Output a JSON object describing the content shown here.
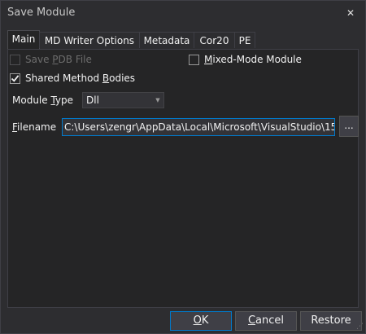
{
  "window": {
    "title": "Save Module",
    "close_glyph": "✕"
  },
  "tabs": [
    {
      "label": "Main",
      "active": true
    },
    {
      "label": "MD Writer Options"
    },
    {
      "label": "Metadata"
    },
    {
      "label": "Cor20"
    },
    {
      "label": "PE"
    }
  ],
  "main": {
    "save_pdb": {
      "label_pre": "Save ",
      "label_u": "P",
      "label_post": "DB File",
      "checked": false,
      "enabled": false
    },
    "mixed_mode": {
      "label_pre": "",
      "label_u": "M",
      "label_post": "ixed-Mode Module",
      "checked": false
    },
    "shared_bodies": {
      "label_pre": "Shared Method ",
      "label_u": "B",
      "label_post": "odies",
      "checked": true
    },
    "module_type": {
      "label_pre": "Module ",
      "label_u": "T",
      "label_post": "ype",
      "value": "Dll"
    },
    "filename": {
      "label": "Filename",
      "value": "C:\\Users\\zengr\\AppData\\Local\\Microsoft\\VisualStudio\\15",
      "browse_label": "..."
    }
  },
  "buttons": {
    "ok": {
      "u": "O",
      "rest": "K"
    },
    "cancel": {
      "u": "C",
      "rest": "ancel"
    },
    "restore": "Restore"
  },
  "colors": {
    "accent": "#007acc",
    "background": "#2d2d30",
    "panel": "#252526"
  }
}
